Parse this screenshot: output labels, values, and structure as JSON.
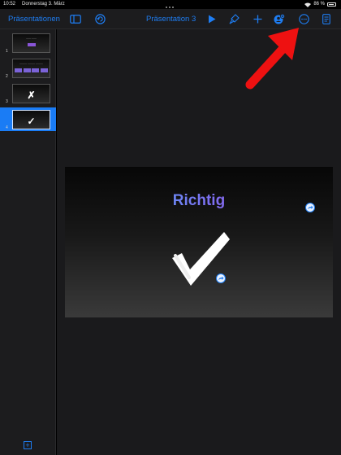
{
  "status_bar": {
    "time": "10:52",
    "date": "Donnerstag 3. März",
    "battery": "86 %"
  },
  "toolbar": {
    "back_label": "Präsentationen",
    "document_title": "Präsentation 3",
    "accent_color": "#1e7df2",
    "icons": [
      "sidebar-icon",
      "undo-icon",
      "play-icon",
      "format-brush-icon",
      "add-icon",
      "collaborate-icon",
      "more-icon",
      "document-icon"
    ]
  },
  "navigator": {
    "slides": [
      {
        "number": "1",
        "selected": false
      },
      {
        "number": "2",
        "selected": false
      },
      {
        "number": "3",
        "selected": false,
        "mark": "✗"
      },
      {
        "number": "4",
        "selected": true,
        "mark": "✓"
      }
    ],
    "add_slide_label": "+"
  },
  "current_slide": {
    "title": "Richtig",
    "mark": "check"
  },
  "annotation": {
    "color": "#ee1111",
    "points_to": "more-icon"
  }
}
